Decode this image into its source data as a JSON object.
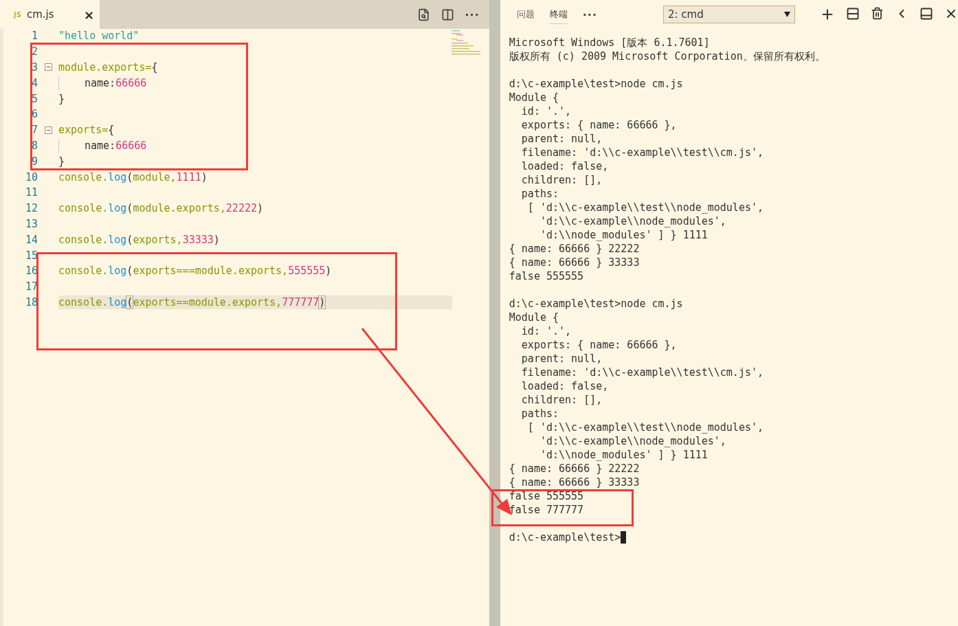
{
  "editor": {
    "tabs": [
      {
        "badge": "JS",
        "label": "cm.js",
        "close": "×",
        "selected": true
      }
    ],
    "more": "···",
    "lines": [
      {
        "number": "1",
        "fold": false,
        "highlighted": false,
        "indent": false,
        "tokens": [
          {
            "kind": "str",
            "text": "\"hello world\""
          }
        ]
      },
      {
        "number": "2",
        "fold": false,
        "highlighted": false,
        "indent": false
      },
      {
        "number": "3",
        "fold": true,
        "highlighted": false,
        "indent": false,
        "tokens": [
          {
            "kind": "var",
            "text": "module.exports="
          },
          {
            "kind": "plain",
            "text": "{"
          }
        ]
      },
      {
        "number": "4",
        "fold": false,
        "highlighted": false,
        "indent": true,
        "tokens": [
          {
            "kind": "plain",
            "text": "name:"
          },
          {
            "kind": "num",
            "text": "66666"
          }
        ]
      },
      {
        "number": "5",
        "fold": false,
        "highlighted": false,
        "indent": false,
        "tokens": [
          {
            "kind": "plain",
            "text": "}"
          }
        ]
      },
      {
        "number": "6",
        "fold": false,
        "highlighted": false,
        "indent": false
      },
      {
        "number": "7",
        "fold": true,
        "highlighted": false,
        "indent": false,
        "tokens": [
          {
            "kind": "var",
            "text": "exports="
          },
          {
            "kind": "plain",
            "text": "{"
          }
        ]
      },
      {
        "number": "8",
        "fold": false,
        "highlighted": false,
        "indent": true,
        "tokens": [
          {
            "kind": "plain",
            "text": "name:"
          },
          {
            "kind": "num",
            "text": "66666"
          }
        ]
      },
      {
        "number": "9",
        "fold": false,
        "highlighted": false,
        "indent": false,
        "tokens": [
          {
            "kind": "plain",
            "text": "}"
          }
        ]
      },
      {
        "number": "10",
        "fold": false,
        "highlighted": false,
        "indent": false,
        "tokens": [
          {
            "kind": "var",
            "text": "console."
          },
          {
            "kind": "fn",
            "text": "log"
          },
          {
            "kind": "plain",
            "text": "("
          },
          {
            "kind": "var",
            "text": "module,"
          },
          {
            "kind": "num",
            "text": "1111"
          },
          {
            "kind": "plain",
            "text": ")"
          }
        ]
      },
      {
        "number": "11",
        "fold": false,
        "highlighted": false,
        "indent": false
      },
      {
        "number": "12",
        "fold": false,
        "highlighted": false,
        "indent": false,
        "tokens": [
          {
            "kind": "var",
            "text": "console."
          },
          {
            "kind": "fn",
            "text": "log"
          },
          {
            "kind": "plain",
            "text": "("
          },
          {
            "kind": "var",
            "text": "module.exports,"
          },
          {
            "kind": "num",
            "text": "22222"
          },
          {
            "kind": "plain",
            "text": ")"
          }
        ]
      },
      {
        "number": "13",
        "fold": false,
        "highlighted": false,
        "indent": false
      },
      {
        "number": "14",
        "fold": false,
        "highlighted": false,
        "indent": false,
        "tokens": [
          {
            "kind": "var",
            "text": "console."
          },
          {
            "kind": "fn",
            "text": "log"
          },
          {
            "kind": "plain",
            "text": "("
          },
          {
            "kind": "var",
            "text": "exports,"
          },
          {
            "kind": "num",
            "text": "33333"
          },
          {
            "kind": "plain",
            "text": ")"
          }
        ]
      },
      {
        "number": "15",
        "fold": false,
        "highlighted": false,
        "indent": false
      },
      {
        "number": "16",
        "fold": false,
        "highlighted": false,
        "indent": false,
        "tokens": [
          {
            "kind": "var",
            "text": "console."
          },
          {
            "kind": "fn",
            "text": "log"
          },
          {
            "kind": "plain",
            "text": "("
          },
          {
            "kind": "var",
            "text": "exports===module.exports,"
          },
          {
            "kind": "num",
            "text": "555555"
          },
          {
            "kind": "plain",
            "text": ")"
          }
        ]
      },
      {
        "number": "17",
        "fold": false,
        "highlighted": false,
        "indent": false
      },
      {
        "number": "18",
        "fold": false,
        "highlighted": true,
        "indent": false,
        "tokens": [
          {
            "kind": "var",
            "text": "console."
          },
          {
            "kind": "fn",
            "text": "log"
          },
          {
            "kind": "bracket",
            "text": "("
          },
          {
            "kind": "var",
            "text": "exports==module.exports,"
          },
          {
            "kind": "num",
            "text": "777777"
          },
          {
            "kind": "bracket",
            "text": ")"
          }
        ]
      }
    ]
  },
  "panel": {
    "tabs": [
      {
        "label": "问题",
        "selected": false
      },
      {
        "label": "终端",
        "selected": true
      }
    ],
    "more": "···",
    "terminal_select": "2: cmd",
    "output": [
      [
        "Microsoft Windows [版本 6.1.7601]",
        "版权所有 (c) 2009 Microsoft Corporation。保留所有权利。"
      ],
      [
        "d:\\c-example\\test>node cm.js",
        "Module {",
        "  id: '.',",
        "  exports: { name: 66666 },",
        "  parent: null,",
        "  filename: 'd:\\\\c-example\\\\test\\\\cm.js',",
        "  loaded: false,",
        "  children: [],",
        "  paths:",
        "   [ 'd:\\\\c-example\\\\test\\\\node_modules',",
        "     'd:\\\\c-example\\\\node_modules',",
        "     'd:\\\\node_modules' ] } 1111",
        "{ name: 66666 } 22222",
        "{ name: 66666 } 33333",
        "false 555555"
      ],
      [
        "d:\\c-example\\test>node cm.js",
        "Module {",
        "  id: '.',",
        "  exports: { name: 66666 },",
        "  parent: null,",
        "  filename: 'd:\\\\c-example\\\\test\\\\cm.js',",
        "  loaded: false,",
        "  children: [],",
        "  paths:",
        "   [ 'd:\\\\c-example\\\\test\\\\node_modules',",
        "     'd:\\\\c-example\\\\node_modules',",
        "     'd:\\\\node_modules' ] } 1111",
        "{ name: 66666 } 22222",
        "{ name: 66666 } 33333",
        "false 555555",
        "false 777777"
      ],
      [
        "d:\\c-example\\test>"
      ]
    ]
  }
}
